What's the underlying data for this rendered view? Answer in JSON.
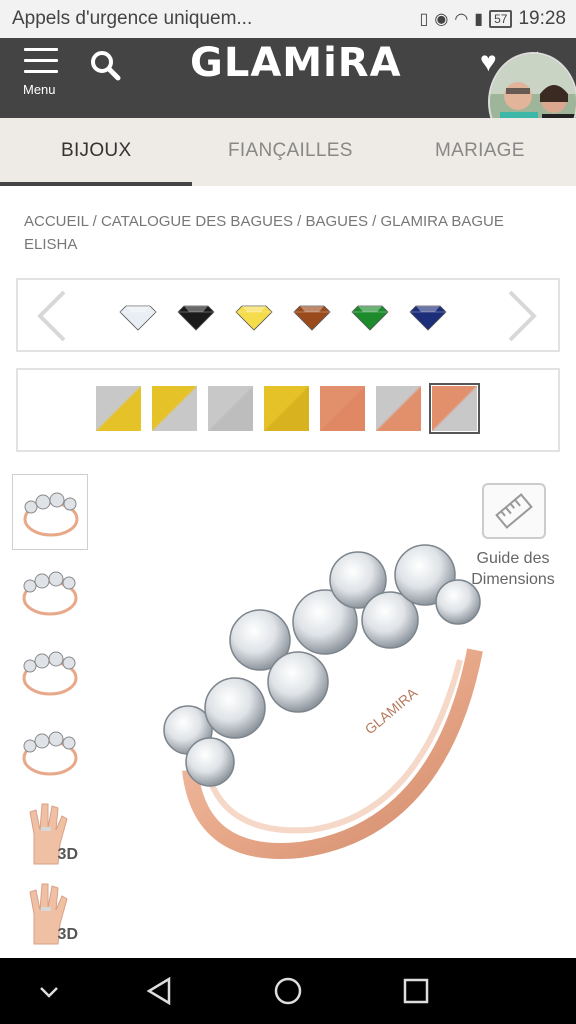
{
  "status_bar": {
    "carrier_text": "Appels d'urgence uniquem...",
    "battery": "57",
    "time": "19:28"
  },
  "header": {
    "menu_label": "Menu",
    "logo": "GLAMiRA"
  },
  "tabs": [
    {
      "label": "BIJOUX"
    },
    {
      "label": "FIANÇAILLES"
    },
    {
      "label": "MARIAGE"
    }
  ],
  "breadcrumb": {
    "text": "ACCUEIL / CATALOGUE DES BAGUES / BAGUES / GLAMIRA BAGUE ELISHA"
  },
  "gemstones": [
    {
      "name": "diamond-white",
      "color": "#e8eef3"
    },
    {
      "name": "black",
      "color": "#1a1a1a"
    },
    {
      "name": "yellow",
      "color": "#f5dc4a"
    },
    {
      "name": "brown",
      "color": "#9b4a1c"
    },
    {
      "name": "green",
      "color": "#1d8a2c"
    },
    {
      "name": "blue",
      "color": "#1c2d7a"
    }
  ],
  "metals": [
    {
      "name": "white-yellow",
      "colors": [
        "#c8c8c8",
        "#e6c229"
      ]
    },
    {
      "name": "yellow-white",
      "colors": [
        "#e6c229",
        "#c8c8c8"
      ]
    },
    {
      "name": "white",
      "colors": [
        "#c8c8c8",
        "#bdbdbd"
      ]
    },
    {
      "name": "yellow",
      "colors": [
        "#e6c229",
        "#d9b21f"
      ]
    },
    {
      "name": "rose",
      "colors": [
        "#e2906c",
        "#e08764"
      ]
    },
    {
      "name": "white-rose",
      "colors": [
        "#c8c8c8",
        "#e2906c"
      ]
    },
    {
      "name": "rose-white",
      "colors": [
        "#e2906c",
        "#c8c8c8"
      ],
      "selected": true
    }
  ],
  "thumbnails": [
    {
      "name": "front",
      "is3d": false,
      "label": ""
    },
    {
      "name": "side",
      "is3d": false,
      "label": ""
    },
    {
      "name": "top",
      "is3d": false,
      "label": ""
    },
    {
      "name": "angle",
      "is3d": false,
      "label": ""
    },
    {
      "name": "hand-3d",
      "is3d": true,
      "label": "3D"
    },
    {
      "name": "hand-3d-2",
      "is3d": true,
      "label": "3D"
    }
  ],
  "size_guide": {
    "label": "Guide des Dimensions"
  },
  "product": {
    "engraving": "GLAMIRA"
  },
  "colors": {
    "header_bg": "#444444",
    "tab_bg": "#eeeae5",
    "rose_gold": "#e8a98a",
    "white_gold": "#d8d8d8"
  }
}
